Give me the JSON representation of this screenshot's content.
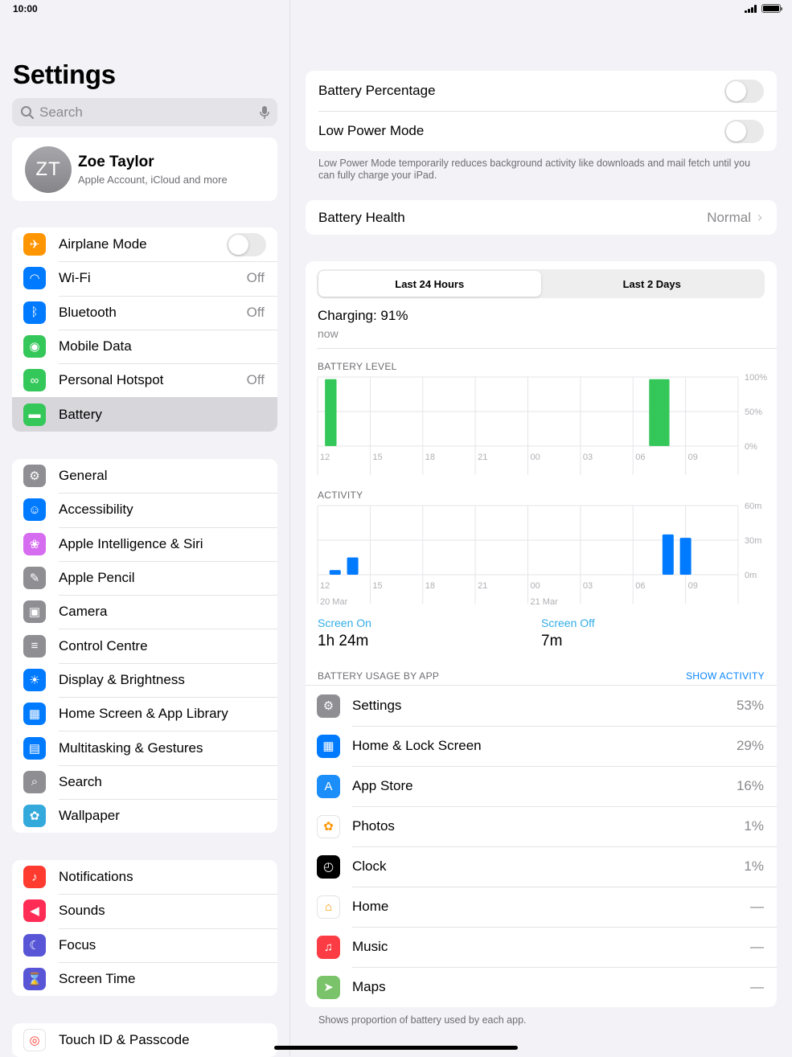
{
  "status": {
    "time": "10:00"
  },
  "sidebar": {
    "title": "Settings",
    "search_placeholder": "Search",
    "profile": {
      "initials": "ZT",
      "name": "Zoe Taylor",
      "subtitle": "Apple Account, iCloud and more"
    },
    "group1": [
      {
        "label": "Airplane Mode",
        "icon": "airplane-icon",
        "color": "#ff9500",
        "toggle": false
      },
      {
        "label": "Wi-Fi",
        "icon": "wifi-icon",
        "color": "#007aff",
        "value": "Off"
      },
      {
        "label": "Bluetooth",
        "icon": "bluetooth-icon",
        "color": "#007aff",
        "value": "Off"
      },
      {
        "label": "Mobile Data",
        "icon": "antenna-icon",
        "color": "#34c759"
      },
      {
        "label": "Personal Hotspot",
        "icon": "hotspot-icon",
        "color": "#34c759",
        "value": "Off"
      },
      {
        "label": "Battery",
        "icon": "battery-icon",
        "color": "#34c759",
        "selected": true
      }
    ],
    "group2": [
      {
        "label": "General",
        "icon": "gear-icon",
        "color": "#8e8e93"
      },
      {
        "label": "Accessibility",
        "icon": "accessibility-icon",
        "color": "#007aff"
      },
      {
        "label": "Apple Intelligence & Siri",
        "icon": "siri-icon",
        "color": "#d66cf0"
      },
      {
        "label": "Apple Pencil",
        "icon": "pencil-icon",
        "color": "#8e8e93"
      },
      {
        "label": "Camera",
        "icon": "camera-icon",
        "color": "#8e8e93"
      },
      {
        "label": "Control Centre",
        "icon": "switches-icon",
        "color": "#8e8e93"
      },
      {
        "label": "Display & Brightness",
        "icon": "sun-icon",
        "color": "#007aff"
      },
      {
        "label": "Home Screen & App Library",
        "icon": "home-screen-icon",
        "color": "#007aff"
      },
      {
        "label": "Multitasking & Gestures",
        "icon": "multitasking-icon",
        "color": "#007aff"
      },
      {
        "label": "Search",
        "icon": "search-icon",
        "color": "#8e8e93"
      },
      {
        "label": "Wallpaper",
        "icon": "flower-icon",
        "color": "#34aadc"
      }
    ],
    "group3": [
      {
        "label": "Notifications",
        "icon": "bell-icon",
        "color": "#ff3b30"
      },
      {
        "label": "Sounds",
        "icon": "speaker-icon",
        "color": "#ff2d55"
      },
      {
        "label": "Focus",
        "icon": "moon-icon",
        "color": "#5856d6"
      },
      {
        "label": "Screen Time",
        "icon": "hourglass-icon",
        "color": "#5856d6"
      }
    ],
    "group4": [
      {
        "label": "Touch ID & Passcode",
        "icon": "fingerprint-icon",
        "color": "#ffffff"
      }
    ]
  },
  "battery": {
    "percentage_label": "Battery Percentage",
    "low_power_label": "Low Power Mode",
    "low_power_note": "Low Power Mode temporarily reduces background activity like downloads and mail fetch until you can fully charge your iPad.",
    "health_label": "Battery Health",
    "health_value": "Normal",
    "tabs": [
      "Last 24 Hours",
      "Last 2 Days"
    ],
    "charging": "Charging: 91%",
    "charging_time": "now",
    "level_caption": "BATTERY LEVEL",
    "activity_caption": "ACTIVITY",
    "screen_on_label": "Screen On",
    "screen_on_value": "1h 24m",
    "screen_off_label": "Screen Off",
    "screen_off_value": "7m",
    "usage_caption": "BATTERY USAGE BY APP",
    "show_activity": "SHOW ACTIVITY",
    "usage_note": "Shows proportion of battery used by each app.",
    "apps": [
      {
        "name": "Settings",
        "value": "53%",
        "icon": "settings-icon",
        "color": "#8e8e93"
      },
      {
        "name": "Home & Lock Screen",
        "value": "29%",
        "icon": "home-screen-icon",
        "color": "#007aff"
      },
      {
        "name": "App Store",
        "value": "16%",
        "icon": "app-store-icon",
        "color": "#1c8ef9"
      },
      {
        "name": "Photos",
        "value": "1%",
        "icon": "photos-icon",
        "color": "#ffffff"
      },
      {
        "name": "Clock",
        "value": "1%",
        "icon": "clock-icon",
        "color": "#000000"
      },
      {
        "name": "Home",
        "value": "—",
        "icon": "home-icon",
        "color": "#ffffff"
      },
      {
        "name": "Music",
        "value": "—",
        "icon": "music-icon",
        "color": "#fc3c44"
      },
      {
        "name": "Maps",
        "value": "—",
        "icon": "maps-icon",
        "color": "#7ac36a"
      }
    ]
  },
  "chart_data": [
    {
      "type": "bar",
      "title": "BATTERY LEVEL",
      "x_ticks": [
        "12",
        "15",
        "18",
        "21",
        "00",
        "03",
        "06",
        "09"
      ],
      "y_ticks": [
        "100%",
        "50%",
        "0%"
      ],
      "ylim": [
        0,
        100
      ],
      "series": [
        {
          "hour_offsets": [
            0.5,
            0.625,
            0.75,
            0.875,
            1.0,
            19.0,
            19.125,
            19.25,
            19.375,
            19.5,
            19.625,
            19.75,
            19.875,
            20.0
          ],
          "values": [
            97,
            97,
            97,
            97,
            97,
            97,
            97,
            97,
            97,
            97,
            97,
            97,
            97,
            97
          ]
        }
      ],
      "color": "#34c759"
    },
    {
      "type": "bar",
      "title": "ACTIVITY",
      "x_ticks": [
        "12",
        "15",
        "18",
        "21",
        "00",
        "03",
        "06",
        "09"
      ],
      "x_subticks": {
        "12": "20 Mar",
        "00": "21 Mar"
      },
      "y_ticks": [
        "60m",
        "30m",
        "0m"
      ],
      "ylim": [
        0,
        60
      ],
      "series": [
        {
          "hour_offsets": [
            1,
            2,
            20,
            21
          ],
          "values": [
            4,
            15,
            35,
            32
          ]
        }
      ],
      "color": "#007aff"
    }
  ]
}
